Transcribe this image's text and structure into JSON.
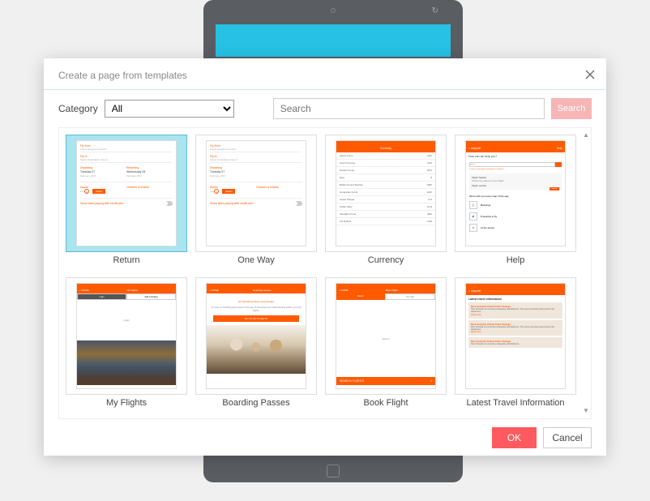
{
  "dialog": {
    "title": "Create a page from templates",
    "category_label": "Category",
    "category_value": "All",
    "search_placeholder": "Search",
    "search_button": "Search",
    "ok_button": "OK",
    "cancel_button": "Cancel"
  },
  "templates": [
    {
      "label": "Return",
      "selected": true
    },
    {
      "label": "One Way",
      "selected": false
    },
    {
      "label": "Currency",
      "selected": false
    },
    {
      "label": "Help",
      "selected": false
    },
    {
      "label": "My Flights",
      "selected": false
    },
    {
      "label": "Boarding Passes",
      "selected": false
    },
    {
      "label": "Book Flight",
      "selected": false
    },
    {
      "label": "Latest Travel Information",
      "selected": false
    }
  ],
  "thumb_content": {
    "return": {
      "fly_from": "Fly from",
      "fly_from_hint": "Select Departure Airport",
      "fly_to": "Fly to",
      "fly_to_hint": "Select Destination Airport",
      "departing": "Departing",
      "returning": "Returning",
      "dep_day": "Tuesday 07",
      "dep_month": "February 2017",
      "ret_day": "Wednesday 08",
      "ret_month": "February 2017",
      "adults": "Adults",
      "children_infants": "Children & Infants",
      "one": "1",
      "select": "Select",
      "show_fares": "Show fares paying with credit card"
    },
    "oneway": {
      "fly_from": "Fly from",
      "fly_from_hint": "Select Departure Airport",
      "fly_to": "Fly to",
      "fly_to_hint": "Select Destination Airport",
      "departing": "Departing",
      "dep_day": "Tuesday 07",
      "dep_month": "February 2017",
      "adults": "Adults",
      "children_infants": "Children & Infants",
      "one": "1",
      "select": "Select",
      "show_fares": "Show fares paying with credit card"
    },
    "currency": {
      "title": "Currency",
      "rows": [
        [
          "Swiss Franc",
          "CHF"
        ],
        [
          "Czech Koruna",
          "CZK"
        ],
        [
          "Danish Krone",
          "DKK"
        ],
        [
          "Euro",
          "€"
        ],
        [
          "British Pound Sterling",
          "GBP"
        ],
        [
          "Hungarian Forint",
          "HUF"
        ],
        [
          "Israeli Sheqel",
          "ILS"
        ],
        [
          "Polish Zloty",
          "PLN"
        ],
        [
          "Swedish Krona",
          "SEK"
        ],
        [
          "US Dollars",
          "USD"
        ]
      ]
    },
    "help": {
      "brand": "easyJet",
      "help_label": "Help",
      "question": "How can we help you?",
      "placeholder": "search",
      "ft_title": "Flight Tracker",
      "ft_sub": "Check the status of your flight",
      "ft_field": "Flight number",
      "search_btn": "Search",
      "every_step": "We're with you every step of the way",
      "items": [
        "Bookings",
        "Preparing to fly",
        "At the airport"
      ]
    },
    "myflights": {
      "title": "My Flights",
      "tab1": "Login",
      "tab2": "Add a booking",
      "body": "Login"
    },
    "boarding": {
      "title": "Boarding passes",
      "msg": "No boarding passes downloaded",
      "desc": "You have no boarding passes saved to this app. To download your mobile boarding passes, go to My Flights.",
      "btn": "GO TO MY FLIGHTS"
    },
    "bookflight": {
      "title": "Book Flight",
      "tab1": "Return",
      "tab2": "One Way",
      "body": "Return",
      "search": "SEARCH FLIGHTS"
    },
    "latest": {
      "heading": "Latest travel information",
      "cards": [
        {
          "title": "Nice Security Check Point Change",
          "text": "Nice Terminal 2 is currently undergoing refurbishment. The current security check point for all departures..."
        },
        {
          "title": "Nice Security Check Point Change",
          "text": "Nice Terminal 2 is currently undergoing refurbishment. The current security check point for all departures..."
        },
        {
          "title": "Nice Security Check Point Change",
          "text": "Nice Terminal 2 is currently undergoing refurbishment..."
        }
      ],
      "more": "Read more"
    }
  }
}
